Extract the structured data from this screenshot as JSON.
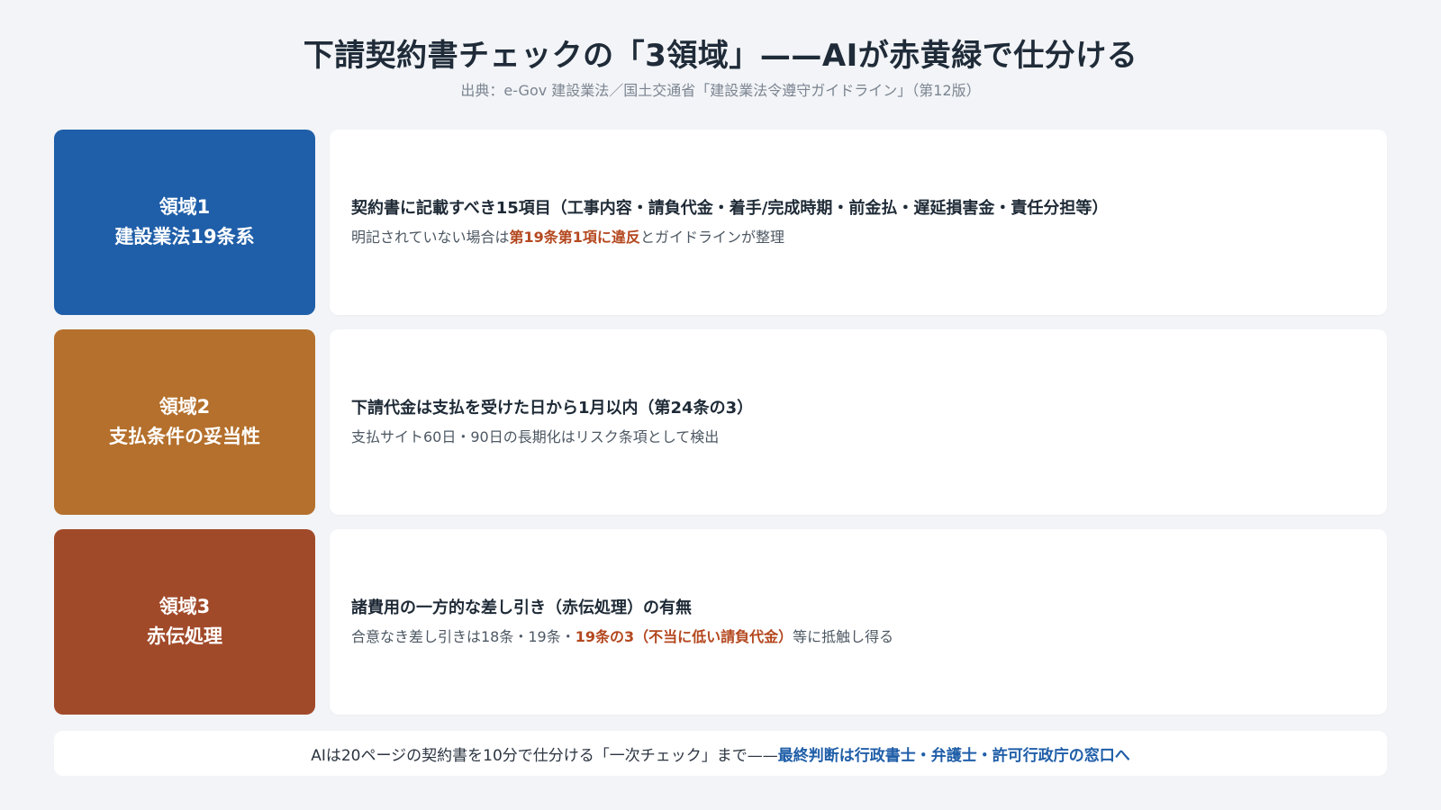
{
  "header": {
    "title": "下請契約書チェックの「3領域」——AIが赤黄緑で仕分ける",
    "source": "出典：e-Gov 建設業法／国土交通省「建設業法令遵守ガイドライン」（第12版）"
  },
  "rows": [
    {
      "tag_line1": "領域1",
      "tag_line2": "建設業法19条系",
      "color": "#1f5ea8",
      "main": "契約書に記載すべき15項目（工事内容・請負代金・着手/完成時期・前金払・遅延損害金・責任分担等）",
      "sub_before": "明記されていない場合は",
      "sub_highlight": "第19条第1項に違反",
      "sub_after": "とガイドラインが整理"
    },
    {
      "tag_line1": "領域2",
      "tag_line2": "支払条件の妥当性",
      "color": "#b4702c",
      "main": "下請代金は支払を受けた日から1月以内（第24条の3）",
      "sub": "支払サイト60日・90日の長期化はリスク条項として検出"
    },
    {
      "tag_line1": "領域3",
      "tag_line2": "赤伝処理",
      "color": "#a14a2a",
      "main": "諸費用の一方的な差し引き（赤伝処理）の有無",
      "sub_before": "合意なき差し引きは18条・19条・",
      "sub_highlight": "19条の3（不当に低い請負代金）",
      "sub_after": "等に抵触し得る"
    }
  ],
  "footer": {
    "text": "AIは20ページの契約書を10分で仕分ける「一次チェック」まで——",
    "highlight": "最終判断は行政書士・弁護士・許可行政庁の窓口へ"
  }
}
